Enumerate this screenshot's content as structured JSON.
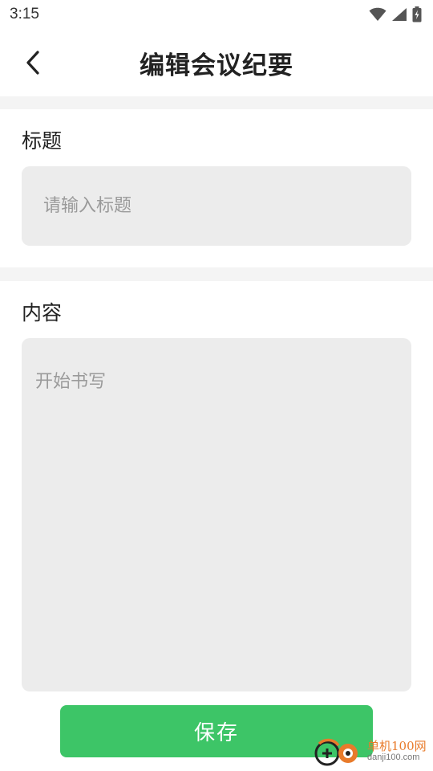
{
  "status_bar": {
    "time": "3:15",
    "icons": [
      "wifi-icon",
      "cellular-signal-icon",
      "battery-charging-icon"
    ]
  },
  "header": {
    "title": "编辑会议纪要",
    "back_icon": "chevron-left-icon"
  },
  "form": {
    "title_section": {
      "label": "标题",
      "value": "",
      "placeholder": "请输入标题"
    },
    "content_section": {
      "label": "内容",
      "value": "",
      "placeholder": "开始书写"
    },
    "save_label": "保存"
  },
  "watermark": {
    "name": "单机100网",
    "url": "danji100.com"
  },
  "colors": {
    "accent": "#3dc567",
    "input_background": "#ececec",
    "divider": "#f4f4f4",
    "placeholder": "#9a9a9a"
  }
}
